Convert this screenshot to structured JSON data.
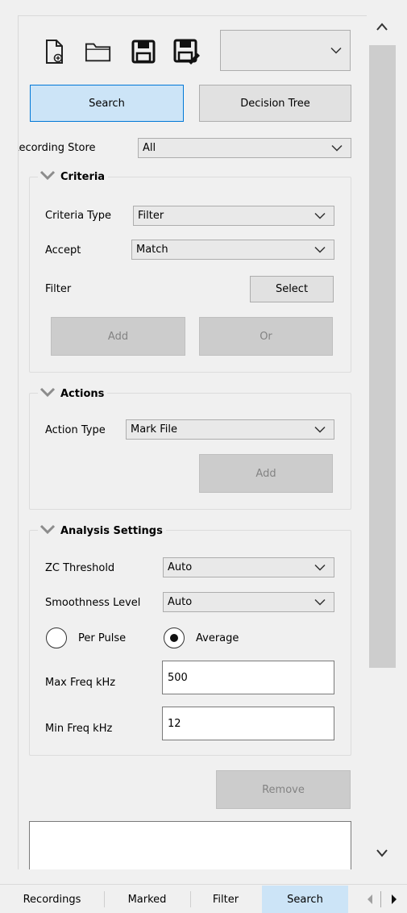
{
  "toolbar": {
    "icons": [
      "new-file-icon",
      "open-folder-icon",
      "save-icon",
      "save-as-icon"
    ],
    "preset_value": ""
  },
  "mode_buttons": {
    "search": "Search",
    "decision_tree": "Decision Tree"
  },
  "recording_store": {
    "label": "Recording Store",
    "value": "All"
  },
  "criteria": {
    "title": "Criteria",
    "criteria_type_label": "Criteria Type",
    "criteria_type_value": "Filter",
    "accept_label": "Accept",
    "accept_value": "Match",
    "filter_label": "Filter",
    "select_button": "Select",
    "add_button": "Add",
    "or_button": "Or"
  },
  "actions": {
    "title": "Actions",
    "action_type_label": "Action Type",
    "action_type_value": "Mark File",
    "add_button": "Add"
  },
  "analysis": {
    "title": "Analysis Settings",
    "zc_label": "ZC Threshold",
    "zc_value": "Auto",
    "smooth_label": "Smoothness Level",
    "smooth_value": "Auto",
    "per_pulse_label": "Per Pulse",
    "average_label": "Average",
    "selected_mode": "Average",
    "max_freq_label": "Max Freq kHz",
    "max_freq_value": "500",
    "min_freq_label": "Min Freq kHz",
    "min_freq_value": "12"
  },
  "remove_button": "Remove",
  "tabs": [
    "Recordings",
    "Marked",
    "Filter",
    "Search"
  ],
  "active_tab": "Search",
  "colors": {
    "accent": "#0078d7",
    "selected_bg": "#cce4f7",
    "disabled_bg": "#cccccc"
  }
}
